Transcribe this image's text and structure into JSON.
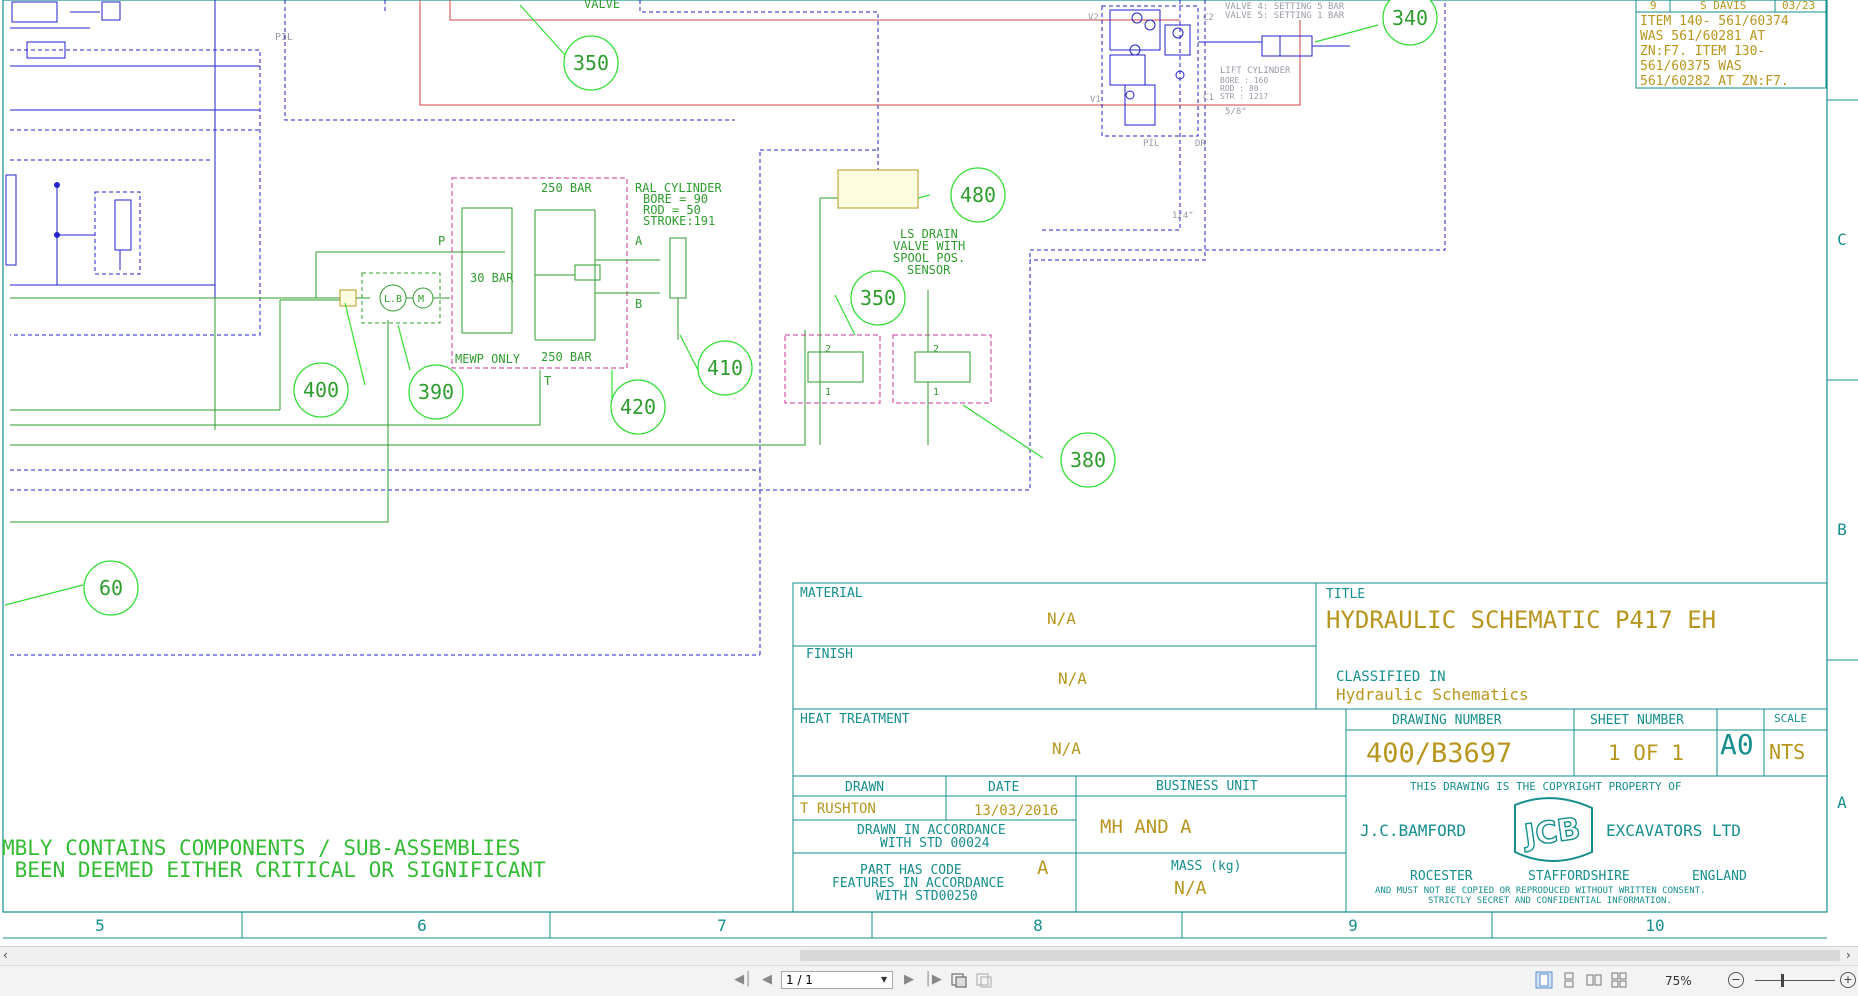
{
  "drawing": {
    "title_block": {
      "material_label": "MATERIAL",
      "material_value": "N/A",
      "finish_label": "FINISH",
      "finish_value": "N/A",
      "heat_treatment_label": "HEAT TREATMENT",
      "heat_treatment_value": "N/A",
      "title_label": "TITLE",
      "title_value": "HYDRAULIC SCHEMATIC P417 EH",
      "classified_label": "CLASSIFIED IN",
      "classified_value": "Hydraulic Schematics",
      "drawing_number_label": "DRAWING NUMBER",
      "drawing_number_value": "400/B3697",
      "sheet_number_label": "SHEET NUMBER",
      "sheet_number_value": "1 OF 1",
      "size_value": "A0",
      "scale_label": "SCALE",
      "scale_value": "NTS",
      "drawn_label": "DRAWN",
      "drawn_value": "T RUSHTON",
      "date_label": "DATE",
      "date_value": "13/03/2016",
      "business_unit_label": "BUSINESS UNIT",
      "business_unit_value": "MH AND A",
      "accordance_line1": "DRAWN IN ACCORDANCE",
      "accordance_line2": "WITH STD 00024",
      "part_code_line1": "PART HAS CODE",
      "part_code_letter": "A",
      "part_code_line2": "FEATURES IN ACCORDANCE",
      "part_code_line3": "WITH STD00250",
      "mass_label": "MASS (kg)",
      "mass_value": "N/A",
      "copyright_line": "THIS DRAWING IS THE COPYRIGHT PROPERTY OF",
      "company_left": "J.C.BAMFORD",
      "company_right": "EXCAVATORS LTD",
      "logo_text": "JCB",
      "town": "ROCESTER",
      "county": "STAFFORDSHIRE",
      "country": "ENGLAND",
      "disclaimer1": "AND MUST NOT BE COPIED OR REPRODUCED WITHOUT WRITTEN CONSENT.",
      "disclaimer2": "STRICTLY SECRET AND CONFIDENTIAL INFORMATION."
    },
    "revision_note": {
      "header_rev": "9",
      "header_initials": "S DAVIS",
      "header_date": "03/23",
      "lines": [
        "ITEM 140- 561/60374",
        "WAS 561/60281 AT",
        "ZN:F7. ITEM 130-",
        "561/60375 WAS",
        "561/60282 AT ZN:F7."
      ]
    },
    "zone_columns": [
      "5",
      "6",
      "7",
      "8",
      "9",
      "10"
    ],
    "zone_rows": [
      "C",
      "B",
      "A"
    ],
    "assembly_note_line1": "MBLY CONTAINS COMPONENTS / SUB-ASSEMBLIES",
    "assembly_note_line2": " BEEN DEEMED EITHER CRITICAL OR SIGNIFICANT",
    "balloons": [
      "350",
      "340",
      "480",
      "350",
      "410",
      "420",
      "400",
      "390",
      "380",
      "60"
    ],
    "labels": {
      "valve": "VALVE",
      "pil_top": "PIL",
      "valve_setting_a": "VALVE 4: SETTING 5 BAR",
      "valve_setting_b": "VALVE 5: SETTING 1 BAR",
      "lift_cylinder": "LIFT CYLINDER",
      "lift_bore": "BORE : 160",
      "lift_rod": "ROD  : 80",
      "lift_str": "STR  : 1217",
      "fraction": "5/8\"",
      "pil_bottom": "PIL",
      "dr": "DR",
      "quarter": "1/4\"",
      "v_upper": "V2",
      "v_lower": "V1",
      "c2": "C2",
      "c1": "C1",
      "bar_250_top": "250 BAR",
      "bar_250_bottom": "250 BAR",
      "bar_30": "30 BAR",
      "mewp_only": "MEWP ONLY",
      "port_p": "P",
      "port_a": "A",
      "port_b": "B",
      "port_t": "T",
      "ral_cylinder": "RAL CYLINDER",
      "ral_bore": "BORE  = 90",
      "ral_rod": "ROD   = 50",
      "ral_stroke": "STROKE:191",
      "ls_line1": "LS DRAIN",
      "ls_line2": "VALVE WITH",
      "ls_line3": "SPOOL POS.",
      "ls_line4": "SENSOR",
      "pos_2a": "2",
      "pos_1a": "1",
      "pos_2b": "2",
      "pos_1b": "1",
      "pump_l": "L.B",
      "motor_m": "M"
    },
    "colors": {
      "green": "#2e9c2e",
      "bright_green": "#33dd33",
      "blue": "#2222cc",
      "teal": "#168e8e",
      "ochre": "#b8961e",
      "magenta": "#cc3399",
      "red": "#d24444"
    }
  },
  "toolbar": {
    "page_value": "1 / 1",
    "zoom_value": "75%",
    "icons": [
      "first-page-icon",
      "prev-page-icon",
      "next-page-icon",
      "last-page-icon"
    ]
  }
}
